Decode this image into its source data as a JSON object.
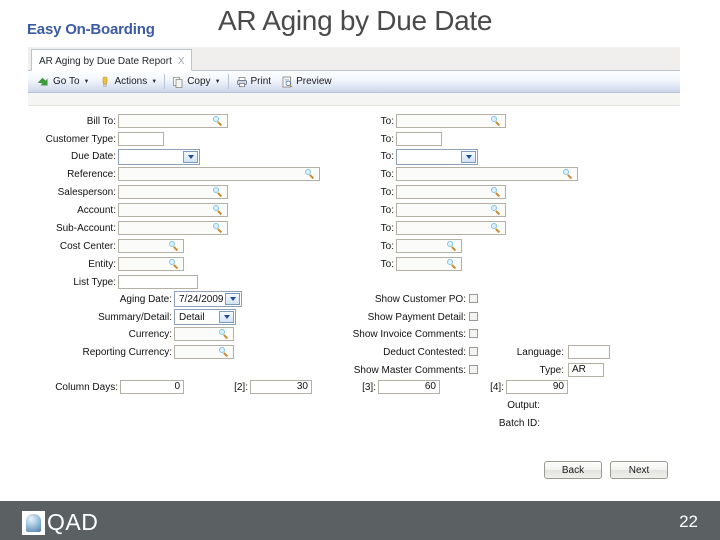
{
  "slide": {
    "brand": "Easy On-Boarding",
    "title": "AR Aging by Due Date",
    "page_number": "22",
    "footer_logo_text": "QAD",
    "brand_color": "#3b5ba5",
    "title_color": "#4a4a4a",
    "footer_color": "#5b6063"
  },
  "app": {
    "tab": {
      "label": "AR Aging by Due Date Report",
      "close": "X"
    },
    "toolbar": [
      {
        "label": "Go To",
        "icon": "go-to-icon",
        "caret": "▼"
      },
      {
        "label": "Actions",
        "icon": "actions-icon",
        "caret": "▼"
      },
      {
        "label": "Copy",
        "icon": "copy-icon",
        "caret": "▼"
      },
      {
        "label": "Print",
        "icon": "print-icon",
        "caret": ""
      },
      {
        "label": "Preview",
        "icon": "preview-icon",
        "caret": ""
      }
    ]
  },
  "form": {
    "range_rows": [
      {
        "label": "Bill To:",
        "value": "",
        "to_label": "To:",
        "to_value": "",
        "type": "lookup",
        "width": "wide"
      },
      {
        "label": "Customer Type:",
        "value": "",
        "to_label": "To:",
        "to_value": "",
        "type": "plain",
        "width": "narrow"
      },
      {
        "label": "Due Date:",
        "value": "",
        "to_label": "To:",
        "to_value": "",
        "type": "dropdown",
        "width": "medium"
      },
      {
        "label": "Reference:",
        "value": "",
        "to_label": "To:",
        "to_value": "",
        "type": "lookup",
        "width": "xwide"
      },
      {
        "label": "Salesperson:",
        "value": "",
        "to_label": "To:",
        "to_value": "",
        "type": "lookup",
        "width": "wide"
      },
      {
        "label": "Account:",
        "value": "",
        "to_label": "To:",
        "to_value": "",
        "type": "lookup",
        "width": "wide"
      },
      {
        "label": "Sub-Account:",
        "value": "",
        "to_label": "To:",
        "to_value": "",
        "type": "lookup",
        "width": "wide"
      },
      {
        "label": "Cost Center:",
        "value": "",
        "to_label": "To:",
        "to_value": "",
        "type": "lookup",
        "width": "narrow"
      },
      {
        "label": "Entity:",
        "value": "",
        "to_label": "To:",
        "to_value": "",
        "type": "lookup",
        "width": "narrow"
      },
      {
        "label": "List Type:",
        "value": "",
        "to_label": "",
        "to_value": "",
        "type": "plain",
        "width": "medium"
      }
    ],
    "option_rows": [
      {
        "label": "Aging Date:",
        "value": "7/24/2009",
        "type": "dropdown"
      },
      {
        "label": "Summary/Detail:",
        "value": "Detail",
        "type": "dropdown"
      },
      {
        "label": "Currency:",
        "value": "",
        "type": "lookup"
      },
      {
        "label": "Reporting Currency:",
        "value": "",
        "type": "lookup"
      }
    ],
    "checkbox_rows": [
      {
        "label": "Show Customer PO:",
        "checked": false
      },
      {
        "label": "Show Payment Detail:",
        "checked": false
      },
      {
        "label": "Show Invoice Comments:",
        "checked": false
      },
      {
        "label": "Deduct Contested:",
        "checked": false
      },
      {
        "label": "Show Master Comments:",
        "checked": false
      }
    ],
    "side_rows": [
      {
        "label": "Language:",
        "value": ""
      },
      {
        "label": "Type:",
        "value": "AR"
      }
    ],
    "column_days": {
      "label": "Column Days:",
      "entries": [
        {
          "label": "",
          "value": "0"
        },
        {
          "label": "[2]:",
          "value": "30"
        },
        {
          "label": "[3]:",
          "value": "60"
        },
        {
          "label": "[4]:",
          "value": "90"
        }
      ]
    },
    "output_rows": [
      {
        "label": "Output:"
      },
      {
        "label": "Batch ID:"
      }
    ],
    "buttons": [
      {
        "label": "Back",
        "name": "back-button"
      },
      {
        "label": "Next",
        "name": "next-button"
      }
    ]
  }
}
